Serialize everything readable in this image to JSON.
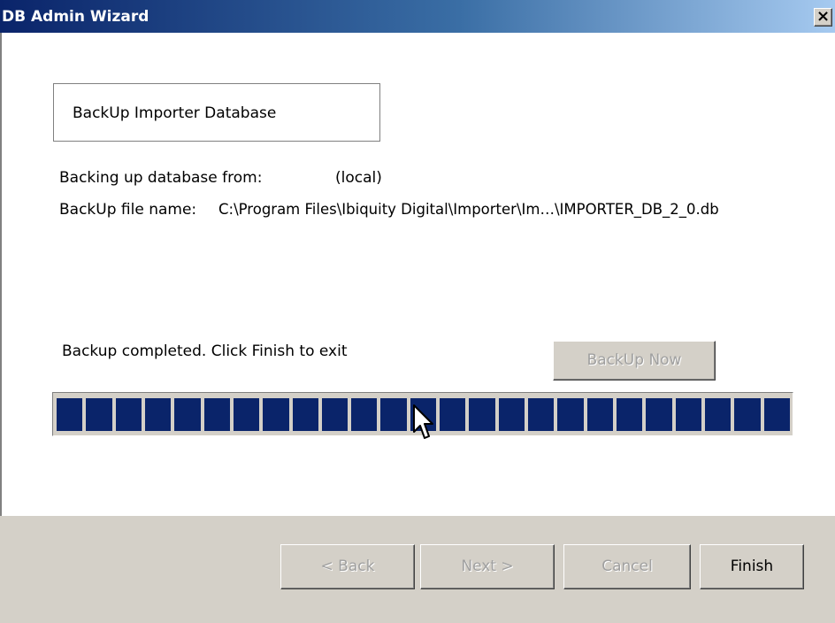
{
  "window": {
    "title": "DB Admin Wizard",
    "close_glyph": "×",
    "close_icon": "close-icon"
  },
  "content": {
    "heading": "BackUp Importer Database",
    "from_label": "Backing up database from:",
    "from_value": "(local)",
    "file_label": "BackUp file name:",
    "file_value": "C:\\Program Files\\Ibiquity Digital\\Importer\\Im…\\IMPORTER_DB_2_0.db",
    "status": "Backup completed. Click Finish to exit",
    "backup_now_label": "BackUp Now"
  },
  "progress": {
    "value": 1.0,
    "segment_color": "#0a246a"
  },
  "buttons": {
    "back": "< Back",
    "next": "Next >",
    "cancel": "Cancel",
    "finish": "Finish"
  },
  "colors": {
    "titlebar_start": "#0a246a",
    "titlebar_end": "#a6caf0",
    "face": "#d4d0c8"
  }
}
